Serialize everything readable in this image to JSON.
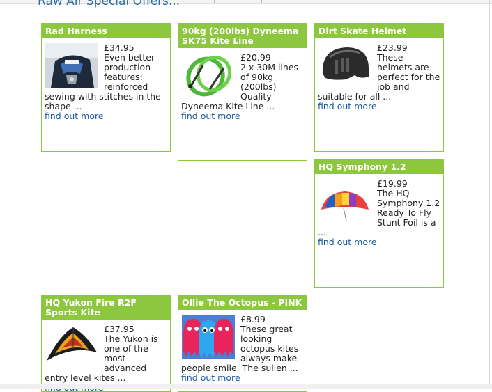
{
  "page": {
    "heading": "Raw Air Special Offers..."
  },
  "products": [
    {
      "title": "Rad Harness",
      "price": "£34.95",
      "description": "Even better production features: reinforced sewing with stitches in the shape ...",
      "link_label": "find out more",
      "image": "harness-photo"
    },
    {
      "title": "90kg (200lbs) Dyneema SK75 Kite Line",
      "price": "£20.99",
      "description": "2 x 30M lines of 90kg (200lbs) Quality Dyneema Kite Line ...",
      "link_label": "find out more",
      "image": "kite-line-reel-photo"
    },
    {
      "title": "Dirt Skate Helmet",
      "price": "£23.99",
      "description": "These helmets are perfect for the job and suitable for all ...",
      "link_label": "find out more",
      "image": "helmet-photo"
    },
    {
      "title": "HQ Symphony 1.2",
      "price": "£19.99",
      "description": "The HQ Symphony 1.2 Ready To Fly Stunt Foil is a ...",
      "link_label": "find out more",
      "image": "foil-kite-photo"
    },
    {
      "title": "HQ Yukon Fire R2F Sports Kite",
      "price": "£37.95",
      "description": "The Yukon is one of the most advanced entry level kites ...",
      "link_label": "find out more",
      "image": "delta-kite-photo"
    },
    {
      "title": "Ollie The Octopus - PINK",
      "price": "£8.99",
      "description": "These great looking octopus kites always make people smile. The sullen ...",
      "link_label": "find out more",
      "image": "octopus-kite-photo"
    }
  ],
  "colors": {
    "card_header": "#8dc63f",
    "card_border": "#8dc63f",
    "heading_text": "#2b6ea8",
    "link": "#1a5aa0"
  }
}
